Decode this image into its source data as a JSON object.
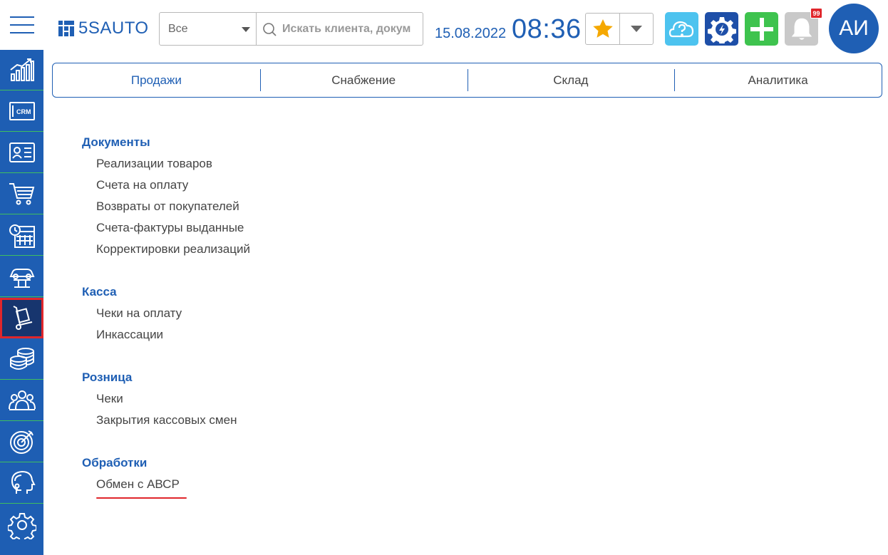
{
  "sidebar": {
    "items": [
      {
        "icon": "chart-growth-icon"
      },
      {
        "icon": "crm-icon",
        "label": "CRM"
      },
      {
        "icon": "contact-card-icon"
      },
      {
        "icon": "shopping-cart-icon"
      },
      {
        "icon": "calendar-clock-icon"
      },
      {
        "icon": "car-lift-icon"
      },
      {
        "icon": "hand-truck-icon",
        "active": true
      },
      {
        "icon": "coins-stack-icon"
      },
      {
        "icon": "people-group-icon"
      },
      {
        "icon": "target-icon"
      },
      {
        "icon": "head-support-icon"
      },
      {
        "icon": "gear-icon"
      }
    ]
  },
  "header": {
    "logo": "5SAUTO",
    "search": {
      "scope": "Все",
      "placeholder": "Искать клиента, документ"
    },
    "date": "15.08.2022",
    "time": "08:36",
    "notifications_count": "99",
    "avatar_initials": "АИ"
  },
  "tabs": [
    "Продажи",
    "Снабжение",
    "Склад",
    "Аналитика"
  ],
  "sections": [
    {
      "title": "Документы",
      "links": [
        "Реализации товаров",
        "Счета на оплату",
        "Возвраты от покупателей",
        "Счета-фактуры выданные",
        "Корректировки реализаций"
      ]
    },
    {
      "title": "Касса",
      "links": [
        "Чеки на оплату",
        "Инкассации"
      ]
    },
    {
      "title": "Розница",
      "links": [
        "Чеки",
        "Закрытия кассовых смен"
      ]
    },
    {
      "title": "Обработки",
      "links": [
        "Обмен с АВСР"
      ]
    }
  ],
  "colors": {
    "accent": "#1f5fb4",
    "sidebar": "#1e5eb3",
    "sidebar_active": "#17356e",
    "highlight": "#e0262b",
    "add_button": "#3ec34e",
    "help_button": "#4dc3ef",
    "star": "#f5a800"
  }
}
